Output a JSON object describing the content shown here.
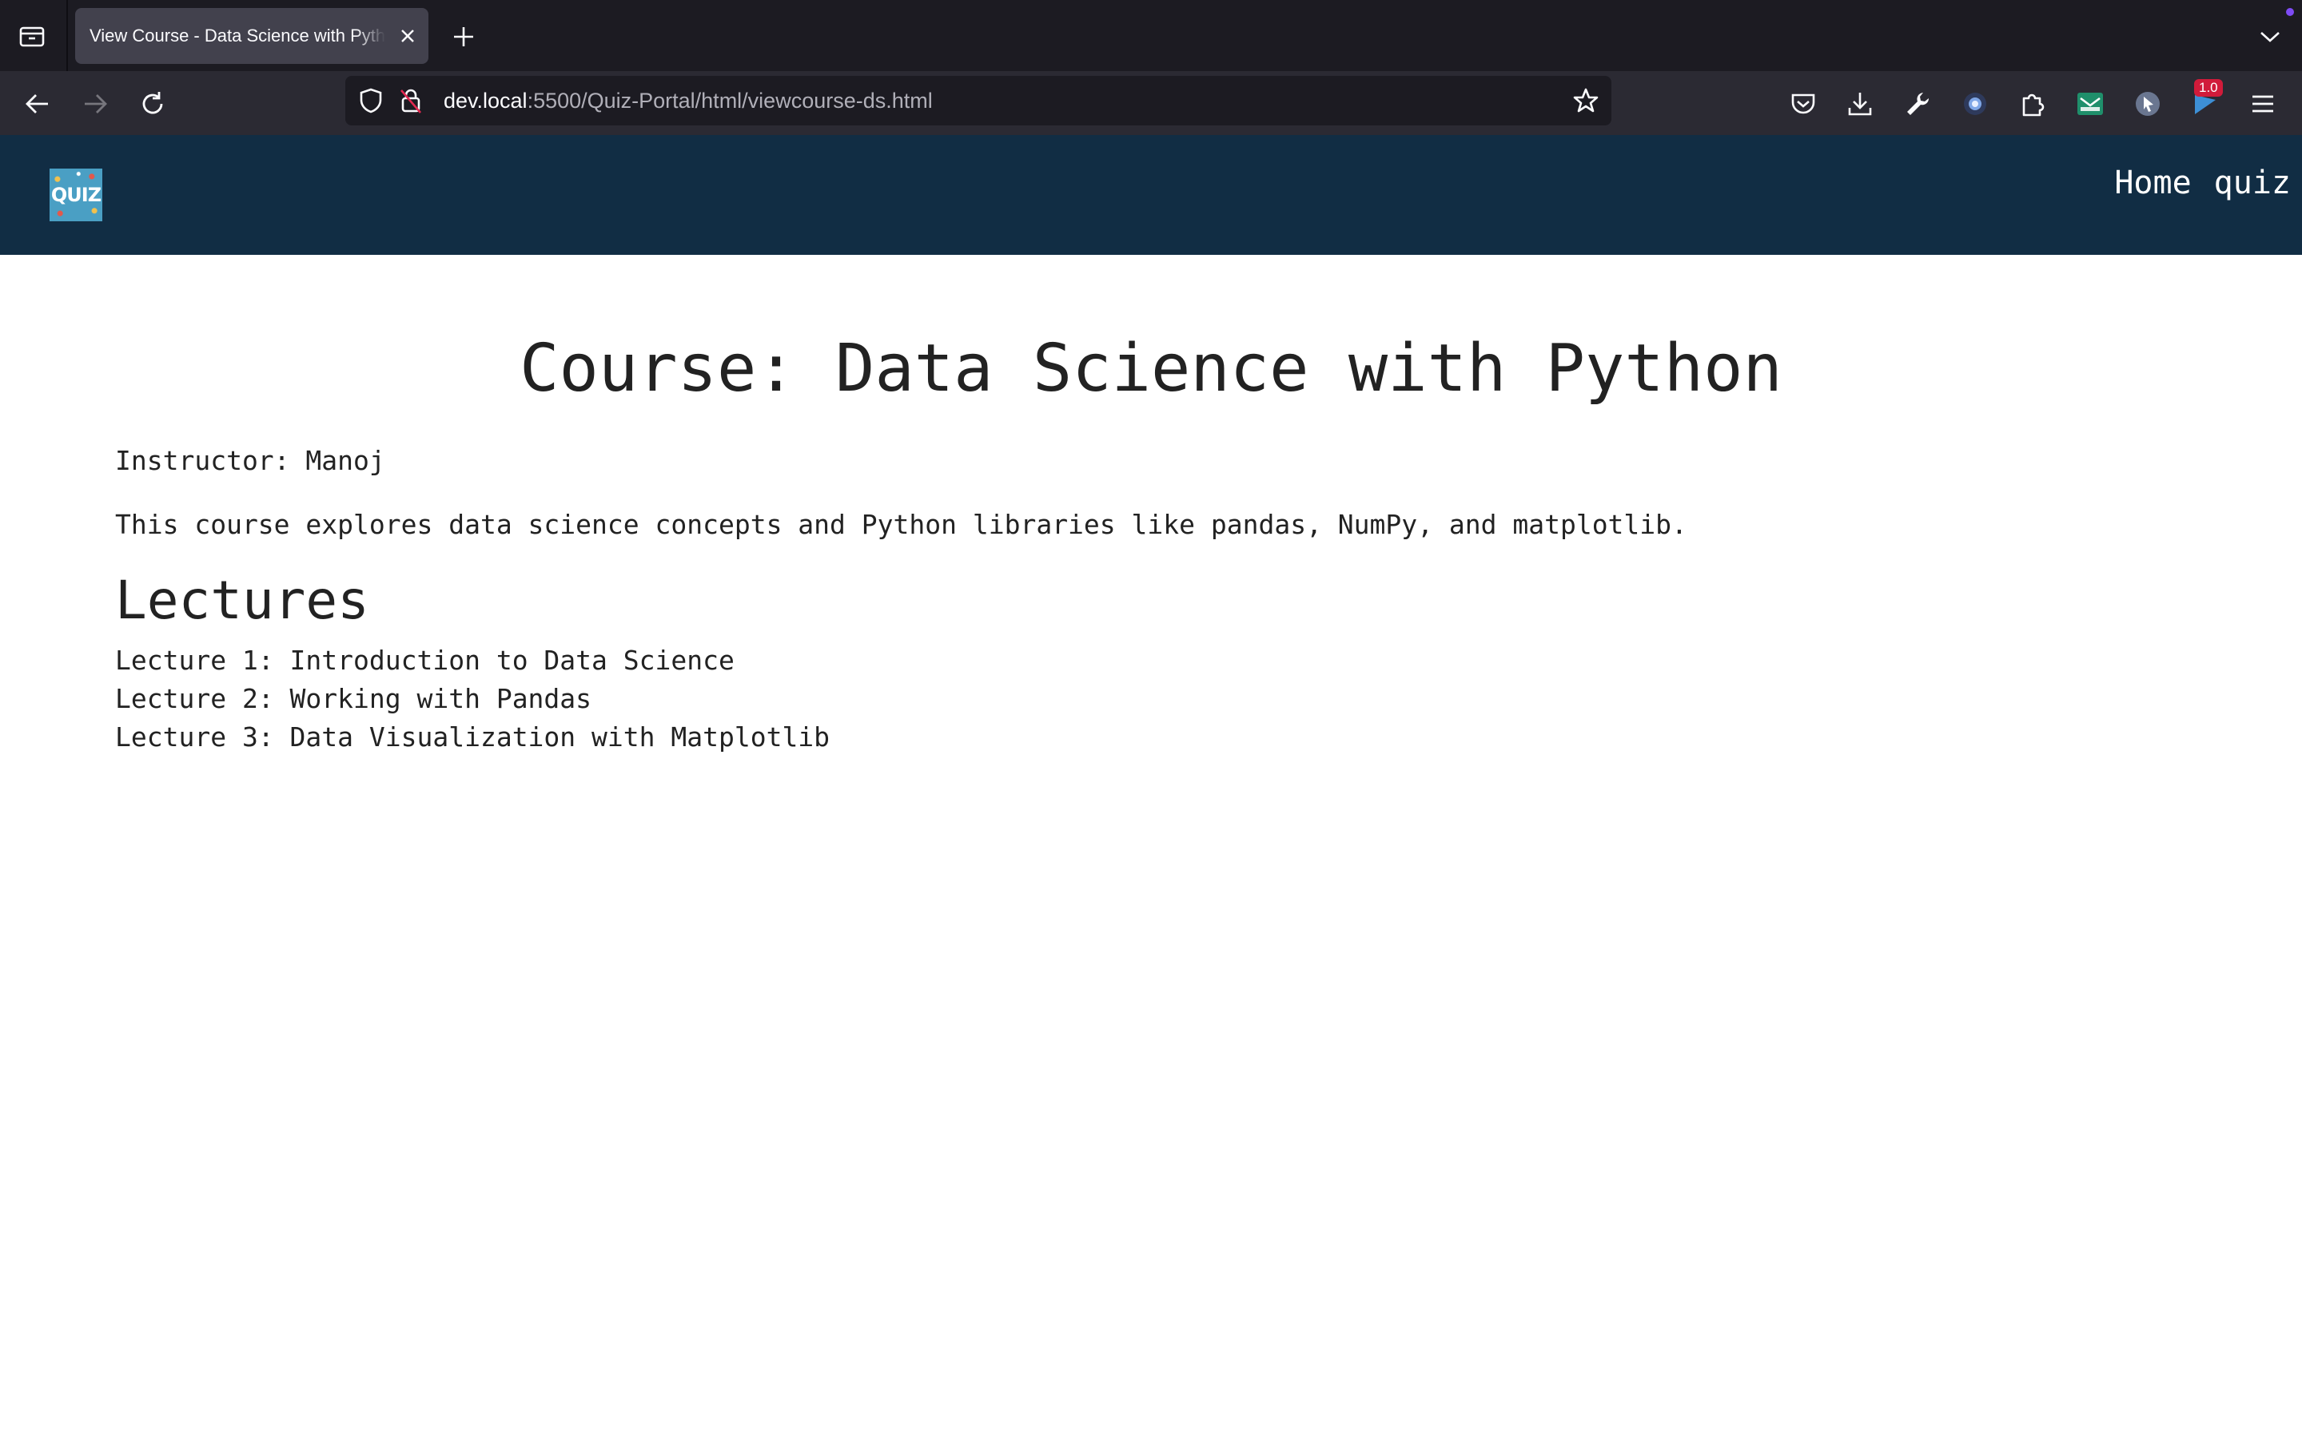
{
  "browser": {
    "tab": {
      "title": "View Course - Data Science with Python",
      "close_icon": "close-icon"
    },
    "url": {
      "host": "dev.local",
      "rest": ":5500/Quiz-Portal/html/viewcourse-ds.html"
    },
    "extension_badge": "1.0",
    "accent_color": "#7e4bf5"
  },
  "site": {
    "logo_text": "QUIZ",
    "header_color": "#112d44",
    "nav": [
      {
        "label": "Home"
      },
      {
        "label": "quiz"
      }
    ]
  },
  "course": {
    "title": "Course: Data Science with Python",
    "instructor": "Instructor: Manoj",
    "description": "This course explores data science concepts and Python libraries like pandas, NumPy, and matplotlib.",
    "lectures_heading": "Lectures",
    "lectures": [
      "Lecture 1: Introduction to Data Science",
      "Lecture 2: Working with Pandas",
      "Lecture 3: Data Visualization with Matplotlib"
    ]
  }
}
